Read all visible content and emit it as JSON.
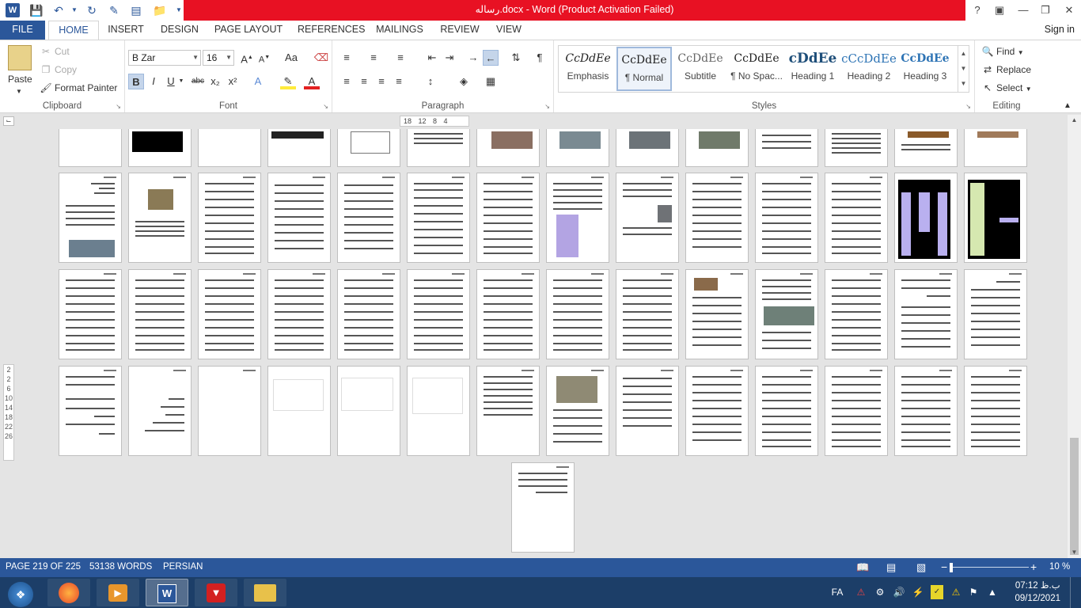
{
  "app": {
    "title": "رساله.docx -  Word (Product Activation Failed)",
    "icon": "word-icon"
  },
  "qat": {
    "save": "save-icon",
    "undo": "undo-icon",
    "redo": "redo-icon",
    "new": "new-document-icon",
    "open": "open-folder-icon"
  },
  "window": {
    "help": "?",
    "restore_ribbon": "ribbon-display-icon",
    "minimize": "minimize-icon",
    "maximize": "restore-icon",
    "close": "close-icon"
  },
  "tabs": {
    "file": "FILE",
    "home": "HOME",
    "insert": "INSERT",
    "design": "DESIGN",
    "page_layout": "PAGE LAYOUT",
    "references": "REFERENCES",
    "mailings": "MAILINGS",
    "review": "REVIEW",
    "view": "VIEW",
    "signin": "Sign in"
  },
  "clipboard": {
    "paste": "Paste",
    "cut": "Cut",
    "copy": "Copy",
    "format_painter": "Format Painter",
    "label": "Clipboard"
  },
  "font": {
    "name": "B Zar",
    "size": "16",
    "label": "Font",
    "case": "Aa",
    "bold": "B",
    "italic": "I",
    "underline": "U",
    "strike": "abc",
    "sub": "x₂",
    "sup": "x²",
    "effects": "A",
    "color": "A"
  },
  "paragraph": {
    "label": "Paragraph",
    "pilcrow": "¶"
  },
  "styles": {
    "label": "Styles",
    "items": [
      {
        "preview": "CcDdEe",
        "name": "Emphasis"
      },
      {
        "preview": "CcDdEe",
        "name": "¶ Normal"
      },
      {
        "preview": "CcDdEe",
        "name": "Subtitle"
      },
      {
        "preview": "CcDdEe",
        "name": "¶ No Spac..."
      },
      {
        "preview": "cDdEe",
        "name": "Heading 1"
      },
      {
        "preview": "cCcDdEe",
        "name": "Heading 2"
      },
      {
        "preview": "CcDdEe",
        "name": "Heading 3"
      }
    ]
  },
  "editing": {
    "find": "Find",
    "replace": "Replace",
    "select": "Select",
    "label": "Editing"
  },
  "ruler": {
    "marks": "18 12 8 4"
  },
  "vruler": {
    "marks": "2 2 6 10 14 18 22 26"
  },
  "status": {
    "page": "PAGE 219 OF 225",
    "words": "53138 WORDS",
    "language": "PERSIAN",
    "zoom": "10 %",
    "zoom_level": 10
  },
  "taskbar": {
    "lang": "FA",
    "time": "07:12 ب.ظ",
    "date": "09/12/2021"
  }
}
